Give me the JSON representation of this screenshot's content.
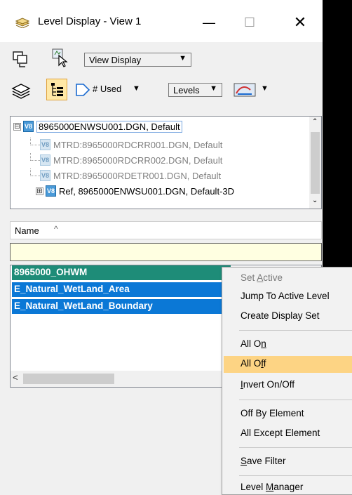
{
  "window": {
    "title": "Level Display - View 1",
    "minimize": "—",
    "maximize": "☐",
    "close": "✕"
  },
  "toolbar": {
    "view_display_label": "View Display",
    "used_label": "# Used",
    "levels_label": "Levels",
    "dropdown_arrow": "▼"
  },
  "tree": {
    "items": [
      {
        "expander": "⊟",
        "label": "8965000ENWSU001.DGN, Default",
        "selected": true,
        "dim": false
      },
      {
        "expander": "",
        "label": "MTRD:8965000RDCRR001.DGN, Default",
        "selected": false,
        "dim": true
      },
      {
        "expander": "",
        "label": "MTRD:8965000RDCRR002.DGN, Default",
        "selected": false,
        "dim": true
      },
      {
        "expander": "",
        "label": "MTRD:8965000RDETR001.DGN, Default",
        "selected": false,
        "dim": true
      },
      {
        "expander": "⊞",
        "label": "Ref, 8965000ENWSU001.DGN, Default-3D",
        "selected": false,
        "dim": false
      }
    ],
    "icon_text": "V8"
  },
  "list": {
    "column_name": "Name",
    "sort_indicator": "^",
    "filter_value": "",
    "levels": [
      {
        "name": "8965000_OHWM",
        "state": "focus"
      },
      {
        "name": "E_Natural_WetLand_Area",
        "state": "selected"
      },
      {
        "name": "E_Natural_WetLand_Boundary",
        "state": "selected"
      }
    ],
    "scroll_left": "<"
  },
  "context_menu": {
    "set_active": {
      "pre": "Set ",
      "acc": "A",
      "post": "ctive"
    },
    "jump_to_active": "Jump To Active Level",
    "create_display_set": "Create Display Set",
    "all_on": {
      "pre": "All O",
      "acc": "n",
      "post": ""
    },
    "all_off": {
      "pre": "All O",
      "acc": "f",
      "post": "f"
    },
    "invert": {
      "pre": "",
      "acc": "I",
      "post": "nvert On/Off"
    },
    "off_by_element": "Off By Element",
    "all_except_element": "All Except Element",
    "save_filter": {
      "pre": "",
      "acc": "S",
      "post": "ave Filter"
    },
    "level_manager": {
      "pre": "Level ",
      "acc": "M",
      "post": "anager"
    },
    "highlight_color": "#fdd484"
  }
}
